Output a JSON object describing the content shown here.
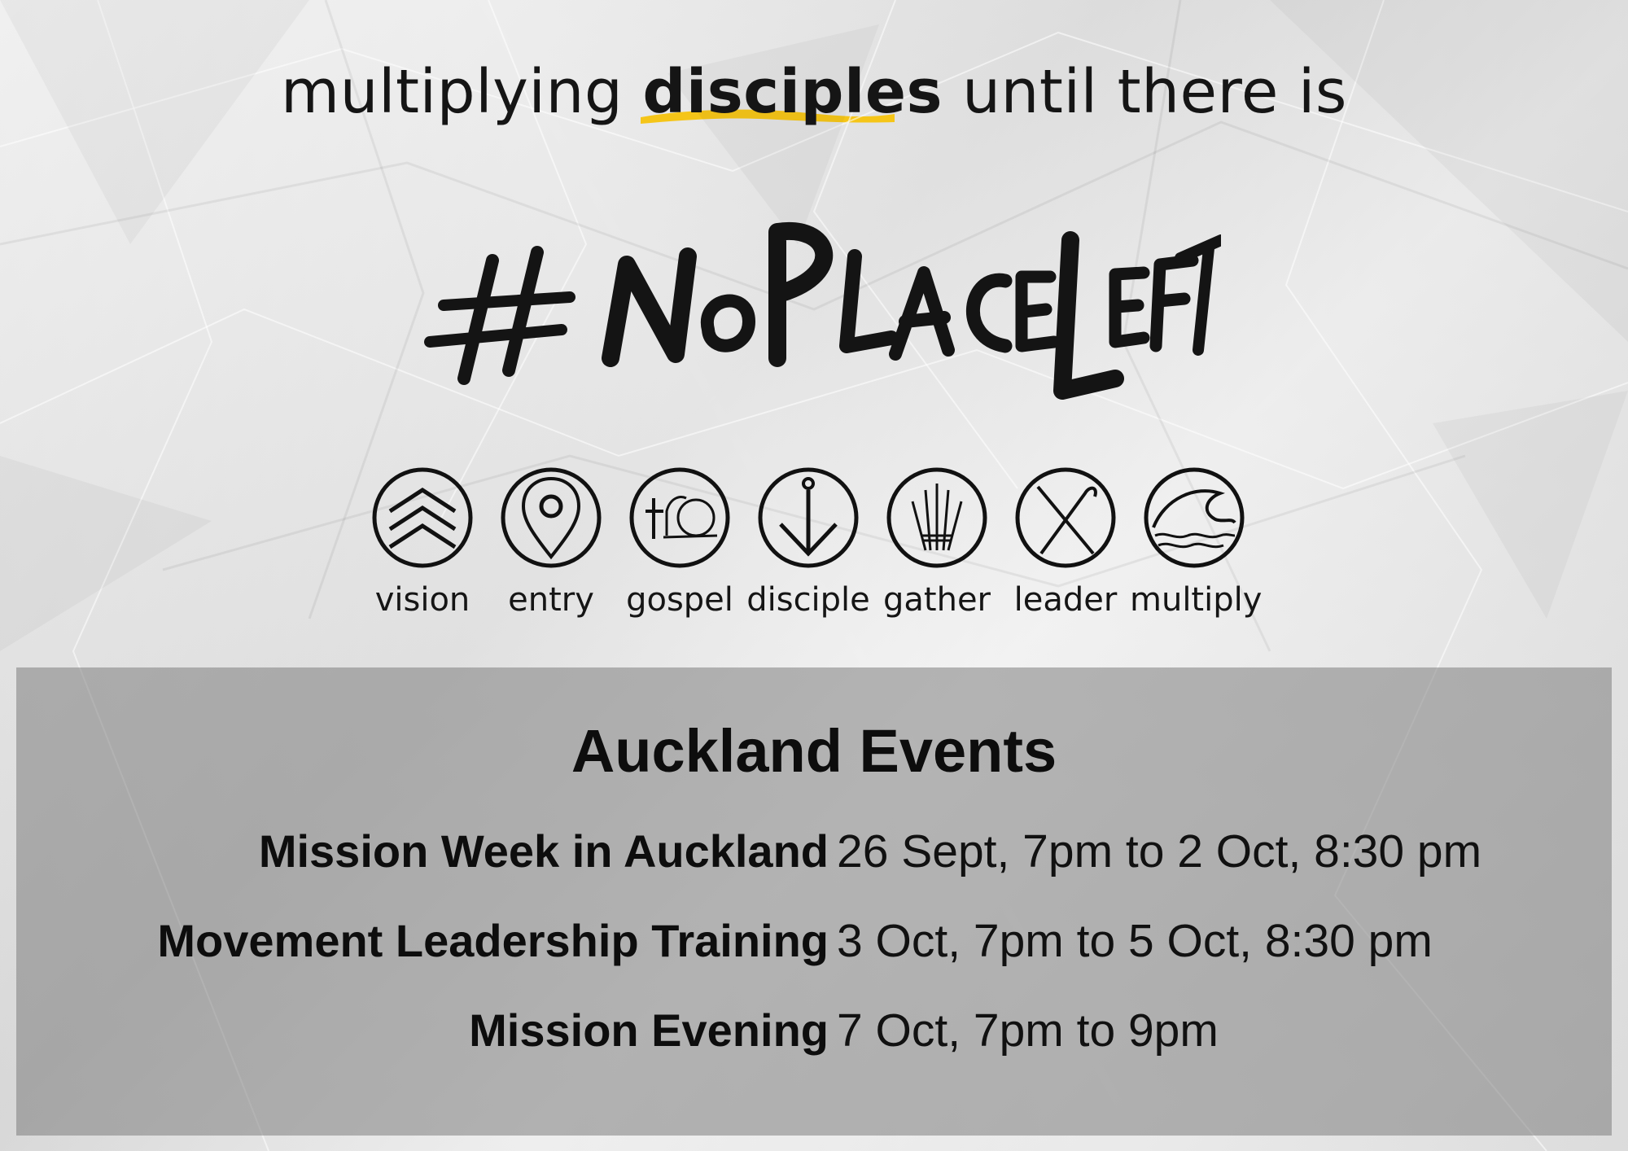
{
  "tagline": {
    "before": "multiplying",
    "highlight": "disciples",
    "after": "until there is"
  },
  "logo": {
    "text": "#NoPlaceLeft"
  },
  "icons": [
    {
      "label": "vision",
      "icon": "chevrons-up-icon"
    },
    {
      "label": "entry",
      "icon": "location-pin-icon"
    },
    {
      "label": "gospel",
      "icon": "cross-tomb-icon"
    },
    {
      "label": "disciple",
      "icon": "anchor-arrow-icon"
    },
    {
      "label": "gather",
      "icon": "wheat-bundle-icon"
    },
    {
      "label": "leader",
      "icon": "crossed-staffs-icon"
    },
    {
      "label": "multiply",
      "icon": "wave-icon"
    }
  ],
  "events": {
    "title": "Auckland Events",
    "items": [
      {
        "name": "Mission Week in Auckland",
        "time": "26 Sept, 7pm to 2 Oct, 8:30 pm"
      },
      {
        "name": "Movement Leadership Training",
        "time": "3 Oct, 7pm to 5 Oct, 8:30 pm"
      },
      {
        "name": "Mission Evening",
        "time": "7 Oct, 7pm to 9pm"
      }
    ]
  },
  "colors": {
    "highlight": "#f5c518",
    "ink": "#111111",
    "panel": "#7a7a7a"
  }
}
